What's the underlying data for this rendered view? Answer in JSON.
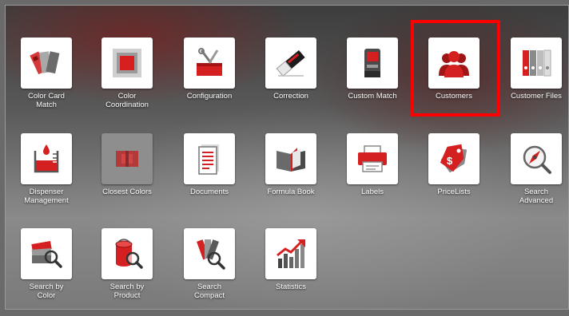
{
  "tiles": [
    {
      "label": "Color Card\nMatch",
      "icon": "color-card-icon"
    },
    {
      "label": "Color\nCoordination",
      "icon": "color-coordination-icon"
    },
    {
      "label": "Configuration",
      "icon": "toolbox-icon"
    },
    {
      "label": "Correction",
      "icon": "eraser-icon"
    },
    {
      "label": "Custom Match",
      "icon": "spectrophotometer-icon"
    },
    {
      "label": "Customers",
      "icon": "customers-icon"
    },
    {
      "label": "Customer Files",
      "icon": "binders-icon"
    },
    {
      "label": "Dispenser\nManagement",
      "icon": "dispenser-icon"
    },
    {
      "label": "Closest Colors",
      "icon": "closest-colors-icon"
    },
    {
      "label": "Documents",
      "icon": "document-icon"
    },
    {
      "label": "Formula Book",
      "icon": "book-icon"
    },
    {
      "label": "Labels",
      "icon": "printer-icon"
    },
    {
      "label": "PriceLists",
      "icon": "price-tag-icon"
    },
    {
      "label": "Search\nAdvanced",
      "icon": "compass-search-icon"
    },
    {
      "label": "Search by\nColor",
      "icon": "swatch-search-icon"
    },
    {
      "label": "Search by\nProduct",
      "icon": "can-search-icon"
    },
    {
      "label": "Search\nCompact",
      "icon": "fan-search-icon"
    },
    {
      "label": "Statistics",
      "icon": "statistics-icon"
    }
  ],
  "colors": {
    "accent": "#cc1a1a",
    "highlight": "#ff0000"
  }
}
